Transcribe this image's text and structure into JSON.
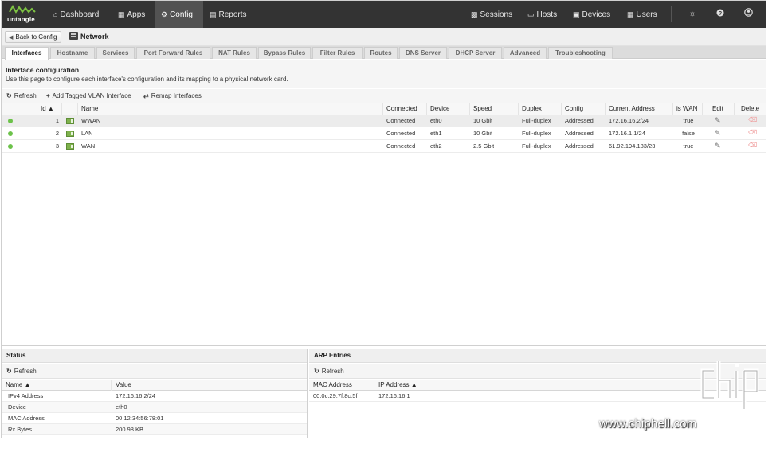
{
  "brand": {
    "name": "untangle"
  },
  "nav": {
    "left": [
      {
        "label": "Dashboard",
        "icon": "home-icon",
        "active": false
      },
      {
        "label": "Apps",
        "icon": "grid-icon",
        "active": false
      },
      {
        "label": "Config",
        "icon": "gear-icon",
        "active": true
      },
      {
        "label": "Reports",
        "icon": "chart-icon",
        "active": false
      }
    ],
    "right": [
      {
        "label": "Sessions",
        "icon": "sessions-icon"
      },
      {
        "label": "Hosts",
        "icon": "hosts-icon"
      },
      {
        "label": "Devices",
        "icon": "devices-icon"
      },
      {
        "label": "Users",
        "icon": "users-icon"
      }
    ],
    "icons": [
      "lightbulb-icon",
      "help-icon",
      "account-icon"
    ]
  },
  "breadcrumb": {
    "back_label": "Back to Config",
    "title": "Network"
  },
  "tabs": [
    "Interfaces",
    "Hostname",
    "Services",
    "Port Forward Rules",
    "NAT Rules",
    "Bypass Rules",
    "Filter Rules",
    "Routes",
    "DNS Server",
    "DHCP Server",
    "Advanced",
    "Troubleshooting"
  ],
  "intro": {
    "title": "Interface configuration",
    "description": "Use this page to configure each interface's configuration and its mapping to a physical network card."
  },
  "toolbar": {
    "refresh": "Refresh",
    "add_vlan": "Add Tagged VLAN Interface",
    "remap": "Remap Interfaces"
  },
  "grid": {
    "columns": {
      "id": "Id",
      "name": "Name",
      "connected": "Connected",
      "device": "Device",
      "speed": "Speed",
      "duplex": "Duplex",
      "config": "Config",
      "address": "Current Address",
      "is_wan": "is WAN",
      "edit": "Edit",
      "delete": "Delete"
    },
    "rows": [
      {
        "id": "1",
        "name": "WWAN",
        "connected": "Connected",
        "device": "eth0",
        "speed": "10 Gbit",
        "duplex": "Full-duplex",
        "config": "Addressed",
        "address": "172.16.16.2/24",
        "is_wan": "true",
        "status_color": "#6cc24a"
      },
      {
        "id": "2",
        "name": "LAN",
        "connected": "Connected",
        "device": "eth1",
        "speed": "10 Gbit",
        "duplex": "Full-duplex",
        "config": "Addressed",
        "address": "172.16.1.1/24",
        "is_wan": "false",
        "status_color": "#6cc24a"
      },
      {
        "id": "3",
        "name": "WAN",
        "connected": "Connected",
        "device": "eth2",
        "speed": "2.5 Gbit",
        "duplex": "Full-duplex",
        "config": "Addressed",
        "address": "61.92.194.183/23",
        "is_wan": "true",
        "status_color": "#6cc24a"
      }
    ]
  },
  "status": {
    "title": "Status",
    "refresh": "Refresh",
    "col_name": "Name",
    "col_value": "Value",
    "rows": [
      {
        "name": "IPv4 Address",
        "value": "172.16.16.2/24"
      },
      {
        "name": "Device",
        "value": "eth0"
      },
      {
        "name": "MAC Address",
        "value": "00:12:34:56:78:01"
      },
      {
        "name": "Rx Bytes",
        "value": "200.98 KB"
      }
    ]
  },
  "arp": {
    "title": "ARP Entries",
    "refresh": "Refresh",
    "col_mac": "MAC Address",
    "col_ip": "IP Address",
    "rows": [
      {
        "mac": "00:0c:29:7f:8c:5f",
        "ip": "172.16.16.1"
      }
    ]
  },
  "watermark": {
    "url": "www.chiphell.com"
  }
}
